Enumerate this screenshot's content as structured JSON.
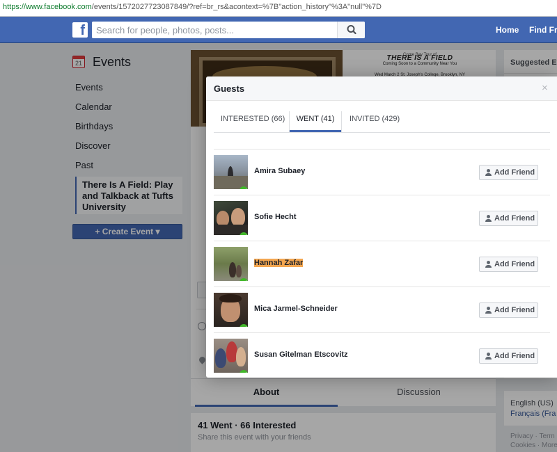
{
  "browser": {
    "url_host": "https://www.facebook.com",
    "url_path": "/events/1572027723087849/?ref=br_rs&acontext=%7B\"action_history\"%3A\"null\"%7D"
  },
  "topbar": {
    "logo": "f",
    "search_placeholder": "Search for people, photos, posts...",
    "nav_home": "Home",
    "nav_find_friends": "Find Frie"
  },
  "sidebar": {
    "calendar_day": "21",
    "title": "Events",
    "items": [
      "Events",
      "Calendar",
      "Birthdays",
      "Discover",
      "Past"
    ],
    "selected_event": "There Is A Field: Play and Talkback at Tufts University",
    "create_label": "+ Create Event ▾"
  },
  "cover": {
    "line1": "Come Bay Tour of",
    "line2": "THERE IS A FIELD",
    "line3": "Coming Soon to a Community Near You",
    "line4": "Wed March 2  St. Joseph's College, Brooklyn, NY"
  },
  "event_tabs": {
    "about": "About",
    "discussion": "Discussion"
  },
  "stats": {
    "counts": "41 Went · 66 Interested",
    "share": "Share this event with your friends"
  },
  "right": {
    "suggested": "Suggested Ev",
    "lang_current": "English (US)",
    "lang_alt": "Français (Fra",
    "footer1": "Privacy · Term",
    "footer2": "Cookies · More"
  },
  "modal": {
    "title": "Guests",
    "close": "×",
    "tabs": {
      "interested": "INTERESTED (66)",
      "went": "WENT (41)",
      "invited": "INVITED (429)"
    },
    "add_friend_label": "Add Friend",
    "guests": [
      {
        "name": "Amira Subaey",
        "highlighted": false
      },
      {
        "name": "Sofie Hecht",
        "highlighted": false
      },
      {
        "name": "Hannah Zafar",
        "highlighted": true
      },
      {
        "name": "Mica Jarmel-Schneider",
        "highlighted": false
      },
      {
        "name": "Susan Gitelman Etscovitz",
        "highlighted": false
      }
    ]
  },
  "colors": {
    "brand": "#4267b2",
    "highlight": "#f3a650",
    "went_check": "#42b72a"
  }
}
